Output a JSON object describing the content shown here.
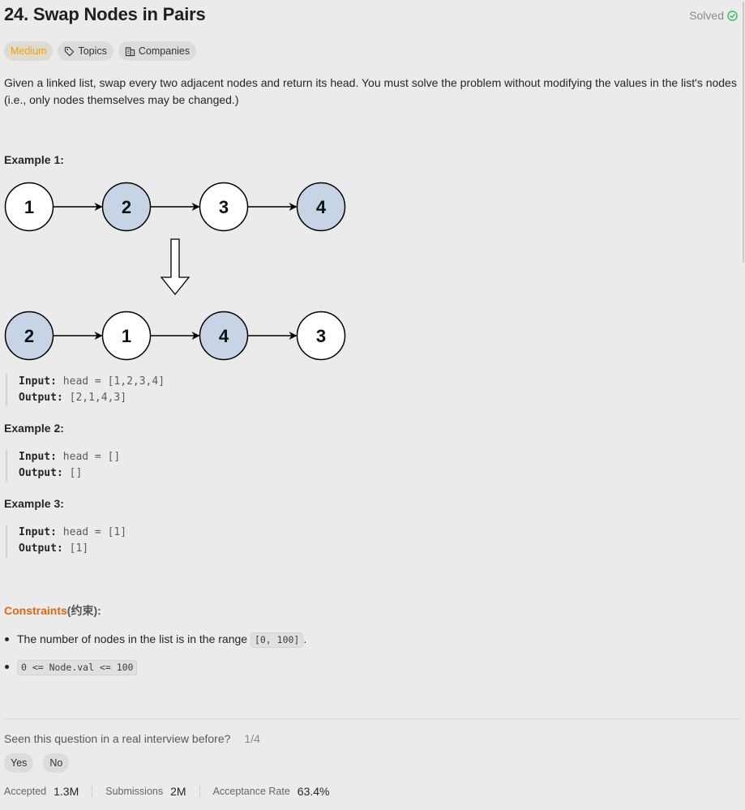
{
  "header": {
    "title": "24. Swap Nodes in Pairs",
    "status": "Solved"
  },
  "tags": {
    "difficulty": "Medium",
    "topics": "Topics",
    "companies": "Companies"
  },
  "description": "Given a linked list, swap every two adjacent nodes and return its head. You must solve the problem without modifying the values in the list's nodes (i.e., only nodes themselves may be changed.)",
  "diagram": {
    "top_row": [
      {
        "label": "1",
        "highlighted": false
      },
      {
        "label": "2",
        "highlighted": true
      },
      {
        "label": "3",
        "highlighted": false
      },
      {
        "label": "4",
        "highlighted": true
      }
    ],
    "bottom_row": [
      {
        "label": "2",
        "highlighted": true
      },
      {
        "label": "1",
        "highlighted": false
      },
      {
        "label": "4",
        "highlighted": true
      },
      {
        "label": "3",
        "highlighted": false
      }
    ],
    "colors": {
      "highlight": "#c6d4e6",
      "plain": "#ffffff",
      "stroke": "#000000"
    }
  },
  "examples": [
    {
      "title": "Example 1:",
      "input_label": "Input:",
      "input_value": "head = [1,2,3,4]",
      "output_label": "Output:",
      "output_value": "[2,1,4,3]"
    },
    {
      "title": "Example 2:",
      "input_label": "Input:",
      "input_value": "head = []",
      "output_label": "Output:",
      "output_value": "[]"
    },
    {
      "title": "Example 3:",
      "input_label": "Input:",
      "input_value": "head = [1]",
      "output_label": "Output:",
      "output_value": "[1]"
    }
  ],
  "constraints": {
    "title": "Constraints",
    "title_suffix": "(约束):",
    "items": [
      {
        "text": "The number of nodes in the list is in the range ",
        "code": "[0, 100]",
        "after": "."
      },
      {
        "text": "",
        "code": "0 <= Node.val <= 100",
        "after": ""
      }
    ],
    "title_color": "#e3660c"
  },
  "interview": {
    "question": "Seen this question in a real interview before?",
    "count": "1/4",
    "yes": "Yes",
    "no": "No"
  },
  "stats": {
    "accepted_label": "Accepted",
    "accepted_value": "1.3M",
    "submissions_label": "Submissions",
    "submissions_value": "2M",
    "rate_label": "Acceptance Rate",
    "rate_value": "63.4%"
  },
  "accent_colors": {
    "medium": "#e8a317",
    "solved": "#2db55d"
  }
}
